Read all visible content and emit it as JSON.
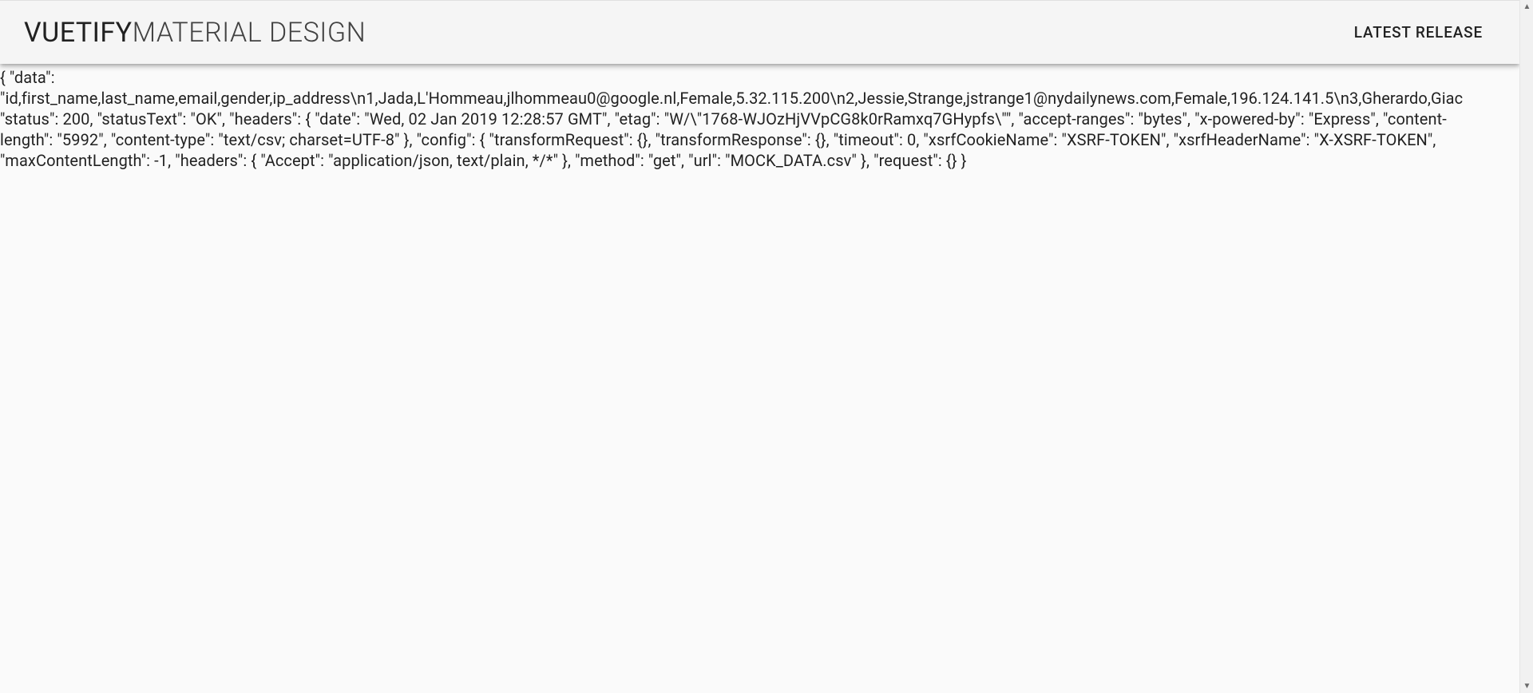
{
  "header": {
    "brand_bold": "VUETIFY",
    "brand_light": "MATERIAL DESIGN",
    "nav_latest_release": "LATEST RELEASE"
  },
  "body": {
    "line1": "{ \"data\":",
    "line2": "\"id,first_name,last_name,email,gender,ip_address\\n1,Jada,L'Hommeau,jlhommeau0@google.nl,Female,5.32.115.200\\n2,Jessie,Strange,jstrange1@nydailynews.com,Female,196.124.141.5\\n3,Gherardo,Giac",
    "line3": "\"status\": 200, \"statusText\": \"OK\", \"headers\": { \"date\": \"Wed, 02 Jan 2019 12:28:57 GMT\", \"etag\": \"W/\\\"1768-WJOzHjVVpCG8k0rRamxq7GHypfs\\\"\", \"accept-ranges\": \"bytes\", \"x-powered-by\": \"Express\", \"content-",
    "line4": "length\": \"5992\", \"content-type\": \"text/csv; charset=UTF-8\" }, \"config\": { \"transformRequest\": {}, \"transformResponse\": {}, \"timeout\": 0, \"xsrfCookieName\": \"XSRF-TOKEN\", \"xsrfHeaderName\": \"X-XSRF-TOKEN\",",
    "line5": "\"maxContentLength\": -1, \"headers\": { \"Accept\": \"application/json, text/plain, */*\" }, \"method\": \"get\", \"url\": \"MOCK_DATA.csv\" }, \"request\": {} }"
  },
  "scrollbar": {
    "up_glyph": "▲",
    "down_glyph": "▼"
  }
}
